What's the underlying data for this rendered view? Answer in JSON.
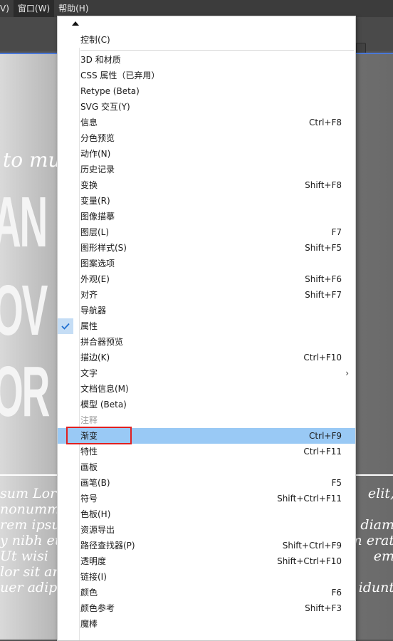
{
  "menubar": {
    "items": [
      "V)",
      "窗口(W)",
      "帮助(H)"
    ]
  },
  "document": {
    "script_text": "to mu",
    "big_lines": [
      "AN",
      "OV",
      "OR"
    ],
    "paragraph_left": [
      "sum Lore",
      "nonumm",
      "rem ipsu",
      "y nibh eu",
      "Ut wisi",
      "lor sit am",
      "uer adipi"
    ],
    "paragraph_right": [
      "elit,",
      "",
      "l diam",
      "m erat",
      "em",
      "",
      "idunt"
    ]
  },
  "menu": {
    "items": [
      {
        "label": "控制(C)",
        "shortcut": ""
      },
      {
        "label": "3D 和材质",
        "shortcut": ""
      },
      {
        "label": "CSS 属性（已弃用）",
        "shortcut": ""
      },
      {
        "label": "Retype (Beta)",
        "shortcut": ""
      },
      {
        "label": "SVG 交互(Y)",
        "shortcut": ""
      },
      {
        "label": "信息",
        "shortcut": "Ctrl+F8"
      },
      {
        "label": "分色预览",
        "shortcut": ""
      },
      {
        "label": "动作(N)",
        "shortcut": ""
      },
      {
        "label": "历史记录",
        "shortcut": ""
      },
      {
        "label": "变换",
        "shortcut": "Shift+F8"
      },
      {
        "label": "变量(R)",
        "shortcut": ""
      },
      {
        "label": "图像描摹",
        "shortcut": ""
      },
      {
        "label": "图层(L)",
        "shortcut": "F7"
      },
      {
        "label": "图形样式(S)",
        "shortcut": "Shift+F5"
      },
      {
        "label": "图案选项",
        "shortcut": ""
      },
      {
        "label": "外观(E)",
        "shortcut": "Shift+F6"
      },
      {
        "label": "对齐",
        "shortcut": "Shift+F7"
      },
      {
        "label": "导航器",
        "shortcut": ""
      },
      {
        "label": "属性",
        "shortcut": ""
      },
      {
        "label": "拼合器预览",
        "shortcut": ""
      },
      {
        "label": "描边(K)",
        "shortcut": "Ctrl+F10"
      },
      {
        "label": "文字",
        "shortcut": ""
      },
      {
        "label": "文档信息(M)",
        "shortcut": ""
      },
      {
        "label": "模型 (Beta)",
        "shortcut": ""
      },
      {
        "label": "注释",
        "shortcut": ""
      },
      {
        "label": "渐变",
        "shortcut": "Ctrl+F9"
      },
      {
        "label": "特性",
        "shortcut": "Ctrl+F11"
      },
      {
        "label": "画板",
        "shortcut": ""
      },
      {
        "label": "画笔(B)",
        "shortcut": "F5"
      },
      {
        "label": "符号",
        "shortcut": "Shift+Ctrl+F11"
      },
      {
        "label": "色板(H)",
        "shortcut": ""
      },
      {
        "label": "资源导出",
        "shortcut": ""
      },
      {
        "label": "路径查找器(P)",
        "shortcut": "Shift+Ctrl+F9"
      },
      {
        "label": "透明度",
        "shortcut": "Shift+Ctrl+F10"
      },
      {
        "label": "链接(I)",
        "shortcut": ""
      },
      {
        "label": "颜色",
        "shortcut": "F6"
      },
      {
        "label": "颜色参考",
        "shortcut": "Shift+F3"
      },
      {
        "label": "魔棒",
        "shortcut": ""
      }
    ]
  },
  "colors": {
    "highlight": "#99c9f5",
    "check_bg": "#c5ddf5",
    "annotation_box": "#e02020"
  }
}
